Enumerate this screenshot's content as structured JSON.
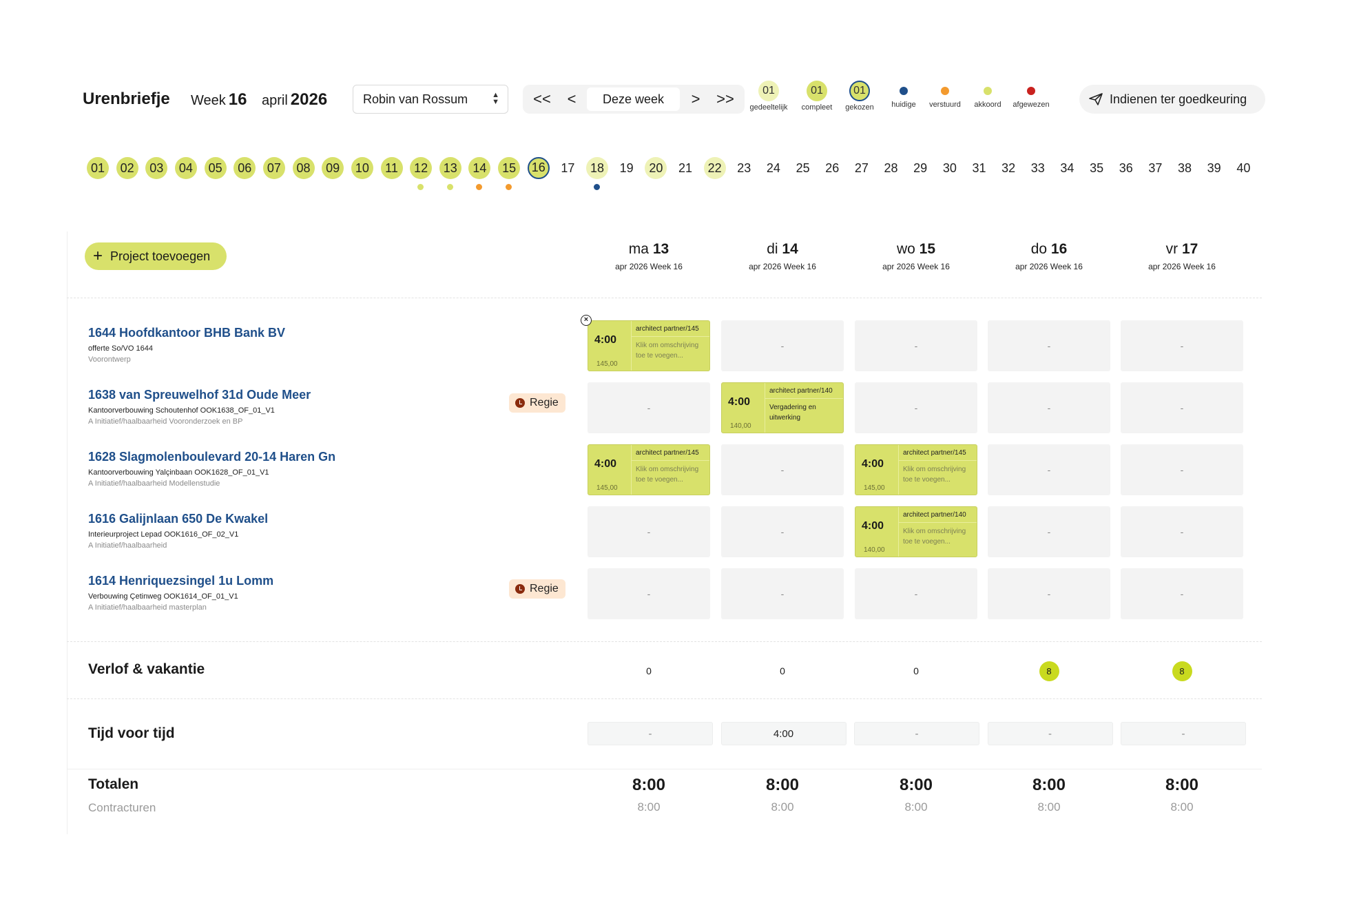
{
  "header": {
    "title": "Urenbriefje",
    "week_label": "Week",
    "week_num": "16",
    "month": "april",
    "year": "2026",
    "user": "Robin van Rossum",
    "nav": {
      "first": "<<",
      "prev": "<",
      "today": "Deze week",
      "next": ">",
      "last": ">>"
    },
    "legend": [
      {
        "label": "gedeeltelijk",
        "num": "01",
        "kind": "circle",
        "bg": "#eef2b6",
        "border": "none"
      },
      {
        "label": "compleet",
        "num": "01",
        "kind": "circle",
        "bg": "#d8e16b",
        "border": "none"
      },
      {
        "label": "gekozen",
        "num": "01",
        "kind": "circle",
        "bg": "#d8e16b",
        "border": "#1f4f8a"
      },
      {
        "label": "huidige",
        "kind": "dot",
        "color": "#1f4f8a"
      },
      {
        "label": "verstuurd",
        "kind": "dot",
        "color": "#f39a2e"
      },
      {
        "label": "akkoord",
        "kind": "dot",
        "color": "#d8e16b"
      },
      {
        "label": "afgewezen",
        "kind": "dot",
        "color": "#c9221f"
      }
    ],
    "submit": "Indienen ter goedkeuring"
  },
  "weeks": [
    {
      "n": "01",
      "s": "compleet"
    },
    {
      "n": "02",
      "s": "compleet"
    },
    {
      "n": "03",
      "s": "compleet"
    },
    {
      "n": "04",
      "s": "compleet"
    },
    {
      "n": "05",
      "s": "compleet"
    },
    {
      "n": "06",
      "s": "compleet"
    },
    {
      "n": "07",
      "s": "compleet"
    },
    {
      "n": "08",
      "s": "compleet"
    },
    {
      "n": "09",
      "s": "compleet"
    },
    {
      "n": "10",
      "s": "compleet"
    },
    {
      "n": "11",
      "s": "compleet"
    },
    {
      "n": "12",
      "s": "compleet",
      "dot": "#d8e16b"
    },
    {
      "n": "13",
      "s": "compleet",
      "dot": "#d8e16b"
    },
    {
      "n": "14",
      "s": "compleet",
      "dot": "#f39a2e"
    },
    {
      "n": "15",
      "s": "compleet",
      "dot": "#f39a2e"
    },
    {
      "n": "16",
      "s": "gekozen"
    },
    {
      "n": "17",
      "s": "none"
    },
    {
      "n": "18",
      "s": "gedeeltelijk",
      "dot": "#1f4f8a"
    },
    {
      "n": "19",
      "s": "none"
    },
    {
      "n": "20",
      "s": "gedeeltelijk"
    },
    {
      "n": "21",
      "s": "none"
    },
    {
      "n": "22",
      "s": "gedeeltelijk"
    },
    {
      "n": "23",
      "s": "none"
    },
    {
      "n": "24",
      "s": "none"
    },
    {
      "n": "25",
      "s": "none"
    },
    {
      "n": "26",
      "s": "none"
    },
    {
      "n": "27",
      "s": "none"
    },
    {
      "n": "28",
      "s": "none"
    },
    {
      "n": "29",
      "s": "none"
    },
    {
      "n": "30",
      "s": "none"
    },
    {
      "n": "31",
      "s": "none"
    },
    {
      "n": "32",
      "s": "none"
    },
    {
      "n": "33",
      "s": "none"
    },
    {
      "n": "34",
      "s": "none"
    },
    {
      "n": "35",
      "s": "none"
    },
    {
      "n": "36",
      "s": "none"
    },
    {
      "n": "37",
      "s": "none"
    },
    {
      "n": "38",
      "s": "none"
    },
    {
      "n": "39",
      "s": "none"
    },
    {
      "n": "40",
      "s": "none"
    }
  ],
  "add_project": "Project toevoegen",
  "days": [
    {
      "dow": "ma",
      "date": "13",
      "sub": "apr 2026 Week 16"
    },
    {
      "dow": "di",
      "date": "14",
      "sub": "apr 2026 Week 16"
    },
    {
      "dow": "wo",
      "date": "15",
      "sub": "apr 2026 Week 16"
    },
    {
      "dow": "do",
      "date": "16",
      "sub": "apr 2026 Week 16"
    },
    {
      "dow": "vr",
      "date": "17",
      "sub": "apr 2026 Week 16"
    }
  ],
  "empty_cell": "-",
  "projects": [
    {
      "title": "1644 Hoofdkantoor BHB Bank BV",
      "sub": "offerte So/VO 1644",
      "phase": "Voorontwerp",
      "regie": null,
      "cells": [
        {
          "time": "4:00",
          "rate": "145,00",
          "role": "architect partner/145",
          "desc": "Klik om omschrijving toe te voegen...",
          "placeholder": true
        },
        null,
        null,
        null,
        null
      ]
    },
    {
      "title": "1638 van Spreuwelhof 31d Oude Meer",
      "sub": "Kantoorverbouwing Schoutenhof OOK1638_OF_01_V1",
      "phase": "A Initiatief/haalbaarheid Vooronderzoek en BP",
      "regie": "Regie",
      "cells": [
        null,
        {
          "time": "4:00",
          "rate": "140,00",
          "role": "architect partner/140",
          "desc": "Vergadering en uitwerking",
          "placeholder": false
        },
        null,
        null,
        null
      ]
    },
    {
      "title": "1628 Slagmolenboulevard 20-14 Haren Gn",
      "sub": "Kantoorverbouwing Yalçinbaan OOK1628_OF_01_V1",
      "phase": "A Initiatief/haalbaarheid Modellenstudie",
      "regie": null,
      "cells": [
        {
          "time": "4:00",
          "rate": "145,00",
          "role": "architect partner/145",
          "desc": "Klik om omschrijving toe te voegen...",
          "placeholder": true
        },
        null,
        {
          "time": "4:00",
          "rate": "145,00",
          "role": "architect partner/145",
          "desc": "Klik om omschrijving toe te voegen...",
          "placeholder": true
        },
        null,
        null
      ]
    },
    {
      "title": "1616 Galijnlaan 650 De Kwakel",
      "sub": "Interieurproject Lepad OOK1616_OF_02_V1",
      "phase": "A Initiatief/haalbaarheid",
      "regie": null,
      "cells": [
        null,
        null,
        {
          "time": "4:00",
          "rate": "140,00",
          "role": "architect partner/140",
          "desc": "Klik om omschrijving toe te voegen...",
          "placeholder": true
        },
        null,
        null
      ]
    },
    {
      "title": "1614 Henriquezsingel 1u Lomm",
      "sub": "Verbouwing Çetinweg OOK1614_OF_01_V1",
      "phase": "A Initiatief/haalbaarheid masterplan",
      "regie": "Regie",
      "cells": [
        null,
        null,
        null,
        null,
        null
      ]
    }
  ],
  "leave": {
    "label": "Verlof & vakantie",
    "values": [
      {
        "v": "0",
        "badge": false
      },
      {
        "v": "0",
        "badge": false
      },
      {
        "v": "0",
        "badge": false
      },
      {
        "v": "8",
        "badge": true
      },
      {
        "v": "8",
        "badge": true
      }
    ]
  },
  "tvt": {
    "label": "Tijd voor tijd",
    "values": [
      "-",
      "4:00",
      "-",
      "-",
      "-"
    ]
  },
  "totals": {
    "label": "Totalen",
    "sub_label": "Contracturen",
    "values": [
      "8:00",
      "8:00",
      "8:00",
      "8:00",
      "8:00"
    ],
    "contract": [
      "8:00",
      "8:00",
      "8:00",
      "8:00",
      "8:00"
    ]
  },
  "colors": {
    "accent": "#d8e16b",
    "accent_light": "#eef2b6",
    "link": "#1f4f8a",
    "regie_bg": "#fde7d2"
  }
}
